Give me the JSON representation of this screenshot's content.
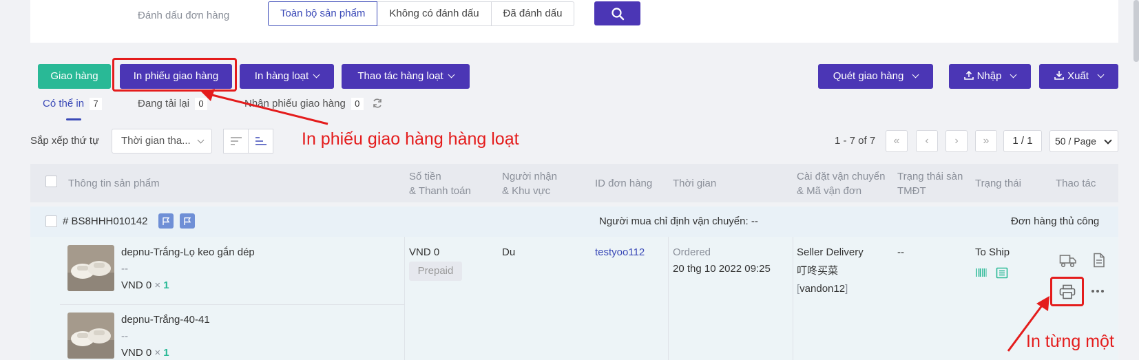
{
  "filter": {
    "label": "Đánh dấu đơn hàng",
    "options": [
      "Toàn bộ sản phẩm",
      "Không có đánh dấu",
      "Đã đánh dấu"
    ],
    "search_icon": "search-icon"
  },
  "toolbar": {
    "ship_label": "Giao hàng",
    "print_delivery_label": "In phiếu giao hàng",
    "batch_print_label": "In hàng loạt",
    "batch_action_label": "Thao tác hàng loạt",
    "scan_label": "Quét giao hàng",
    "import_label": "Nhập",
    "export_label": "Xuất"
  },
  "tabs": [
    {
      "label": "Có thể in",
      "count": "7"
    },
    {
      "label": "Đang tải lại",
      "count": "0"
    },
    {
      "label": "Nhận phiếu giao hàng",
      "count": "0"
    }
  ],
  "sort": {
    "label": "Sắp xếp thứ tự",
    "value": "Thời gian tha..."
  },
  "annotations": {
    "batch_print": "In phiếu giao hàng hàng loạt",
    "single_print": "In từng một"
  },
  "pagination": {
    "info": "1 - 7 of 7",
    "current": "1 / 1",
    "page_size": "50 / Page"
  },
  "table": {
    "headers": {
      "product": "Thông tin sản phẩm",
      "amount_1": "Số tiền",
      "amount_2": "& Thanh toán",
      "receiver_1": "Người nhận",
      "receiver_2": "& Khu vực",
      "order_id": "ID đơn hàng",
      "time": "Thời gian",
      "shipping_1": "Cài đặt vận chuyển",
      "shipping_2": "& Mã vận đơn",
      "platform_1": "Trạng thái sàn",
      "platform_2": "TMĐT",
      "status": "Trạng thái",
      "action": "Thao tác"
    }
  },
  "order": {
    "number": "# BS8HHH010142",
    "buyer_shipping": "Người mua chỉ định vận chuyển: --",
    "order_type": "Đơn hàng thủ công",
    "products": [
      {
        "name": "depnu-Trắng-Lọ keo gắn dép",
        "variant": "--",
        "price": "VND 0",
        "times": "×",
        "qty": "1"
      },
      {
        "name": "depnu-Trắng-40-41",
        "variant": "--",
        "price": "VND 0",
        "times": "×",
        "qty": "1"
      }
    ],
    "amount": "VND 0",
    "payment": "Prepaid",
    "receiver": "Du",
    "order_id": "testyoo112",
    "time_label": "Ordered",
    "time_value": "20 thg 10 2022 09:25",
    "carrier": "Seller Delivery",
    "carrier_cn": "叮咚买菜",
    "tracking_open": "[",
    "tracking": "vandon12",
    "tracking_close": "]",
    "platform_status": "--",
    "status": "To Ship"
  },
  "colors": {
    "primary": "#4b36b5",
    "green": "#29b996",
    "annotation_red": "#e41c1c"
  }
}
